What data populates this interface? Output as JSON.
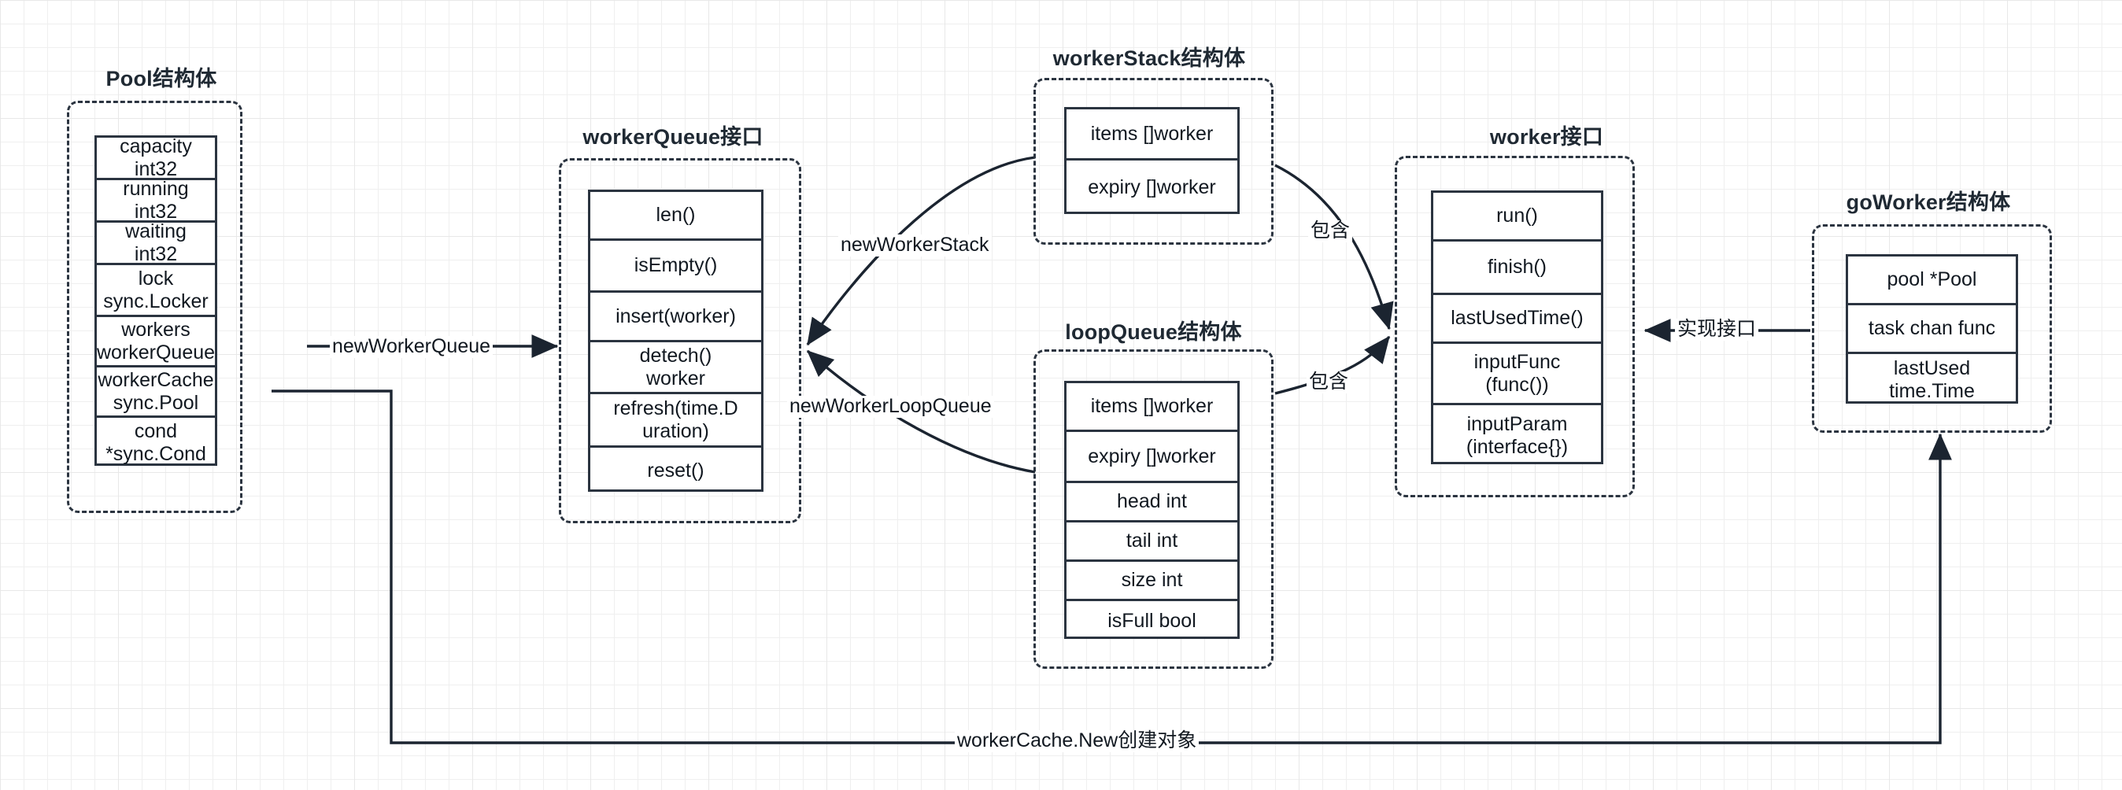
{
  "diagram": {
    "title_note": "ants goroutine pool structure relationship diagram",
    "groups": [
      {
        "id": "pool",
        "title": "Pool结构体",
        "fields": [
          "capacity int32",
          "running int32",
          "waiting int32",
          "lock\nsync.Locker",
          "workers\nworkerQueue",
          "workerCache\nsync.Pool",
          "cond\n*sync.Cond"
        ]
      },
      {
        "id": "worker-queue",
        "title": "workerQueue接口",
        "fields": [
          "len()",
          "isEmpty()",
          "insert(worker)",
          "detech()\nworker",
          "refresh(time.D\nuration)",
          "reset()"
        ]
      },
      {
        "id": "worker-stack",
        "title": "workerStack结构体",
        "fields": [
          "items []worker",
          "expiry []worker"
        ]
      },
      {
        "id": "loop-queue",
        "title": "loopQueue结构体",
        "fields": [
          "items []worker",
          "expiry []worker",
          "head int",
          "tail int",
          "size int",
          "isFull bool"
        ]
      },
      {
        "id": "worker",
        "title": "worker接口",
        "fields": [
          "run()",
          "finish()",
          "lastUsedTime()",
          "inputFunc\n(func())",
          "inputParam\n(interface{})"
        ]
      },
      {
        "id": "go-worker",
        "title": "goWorker结构体",
        "fields": [
          "pool *Pool",
          "task chan func",
          "lastUsed\ntime.Time"
        ]
      }
    ],
    "edges": [
      {
        "id": "pool-to-workerqueue",
        "label": "newWorkerQueue",
        "from": "pool",
        "to": "worker-queue"
      },
      {
        "id": "workerstack-to-workerqueue",
        "label": "newWorkerStack",
        "from": "worker-stack",
        "to": "worker-queue"
      },
      {
        "id": "loopqueue-to-workerqueue",
        "label": "newWorkerLoopQueue",
        "from": "loop-queue",
        "to": "worker-queue"
      },
      {
        "id": "workerstack-to-worker",
        "label": "包含",
        "from": "worker-stack",
        "to": "worker"
      },
      {
        "id": "loopqueue-to-worker",
        "label": "包含",
        "from": "loop-queue",
        "to": "worker"
      },
      {
        "id": "goworker-to-worker",
        "label": "实现接口",
        "from": "go-worker",
        "to": "worker"
      },
      {
        "id": "pool-to-goworker",
        "label": "workerCache.New创建对象",
        "from": "pool",
        "to": "go-worker"
      }
    ],
    "colors": {
      "stroke": "#2b3440",
      "text": "#111820",
      "background": "#ffffff",
      "grid_minor": "#efefef",
      "grid_major": "#e8e8e8"
    }
  }
}
